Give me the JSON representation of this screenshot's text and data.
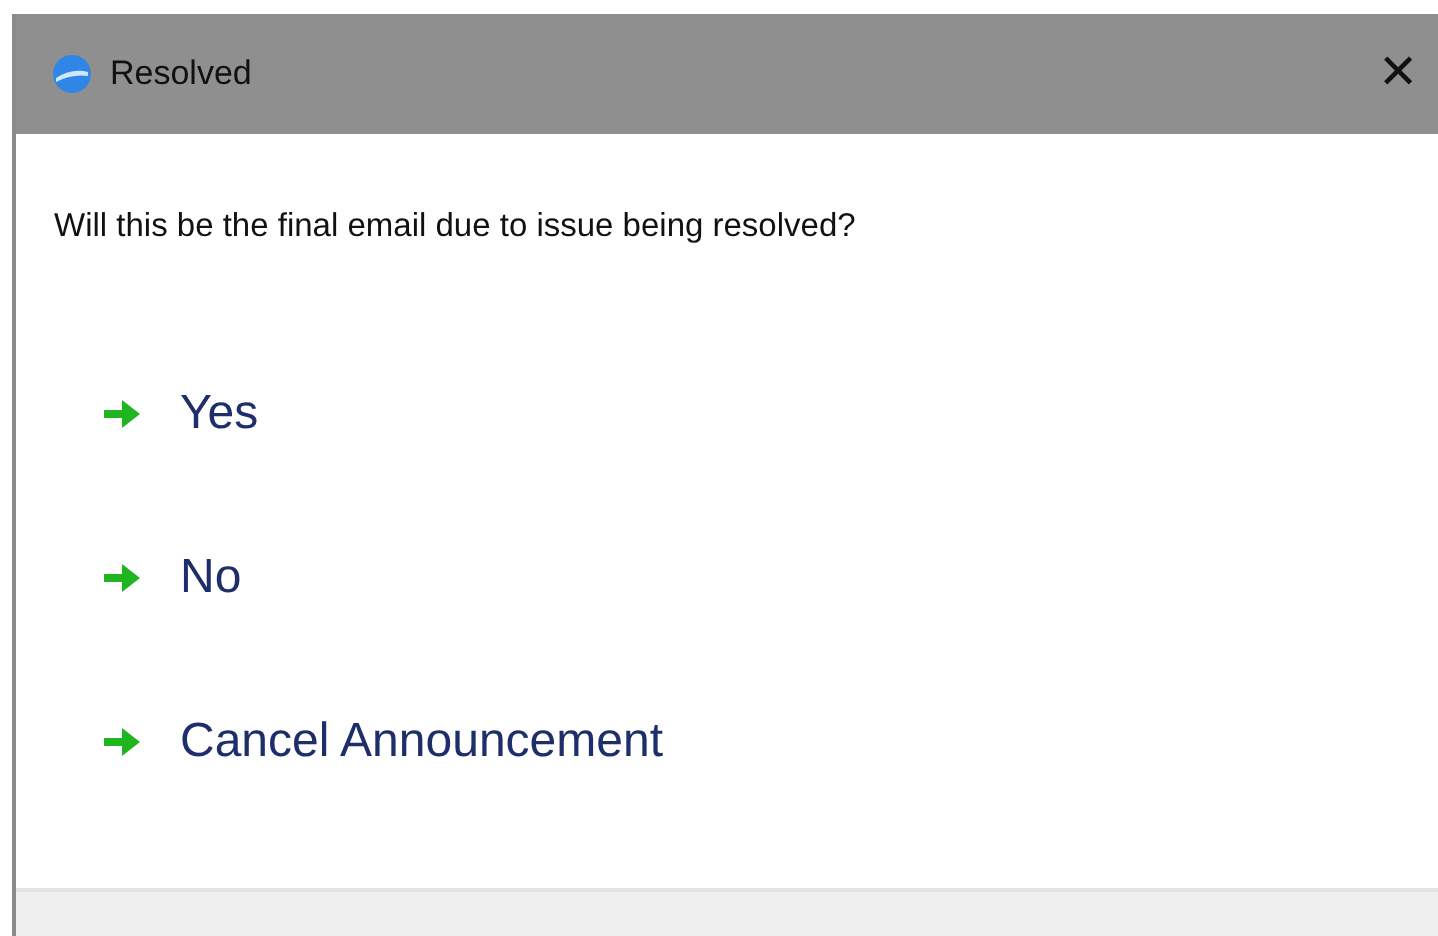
{
  "window": {
    "title": "Resolved",
    "close": "✕"
  },
  "question": "Will this be the final email due to issue being resolved?",
  "options": [
    {
      "label": "Yes"
    },
    {
      "label": "No"
    },
    {
      "label": "Cancel Announcement"
    }
  ]
}
